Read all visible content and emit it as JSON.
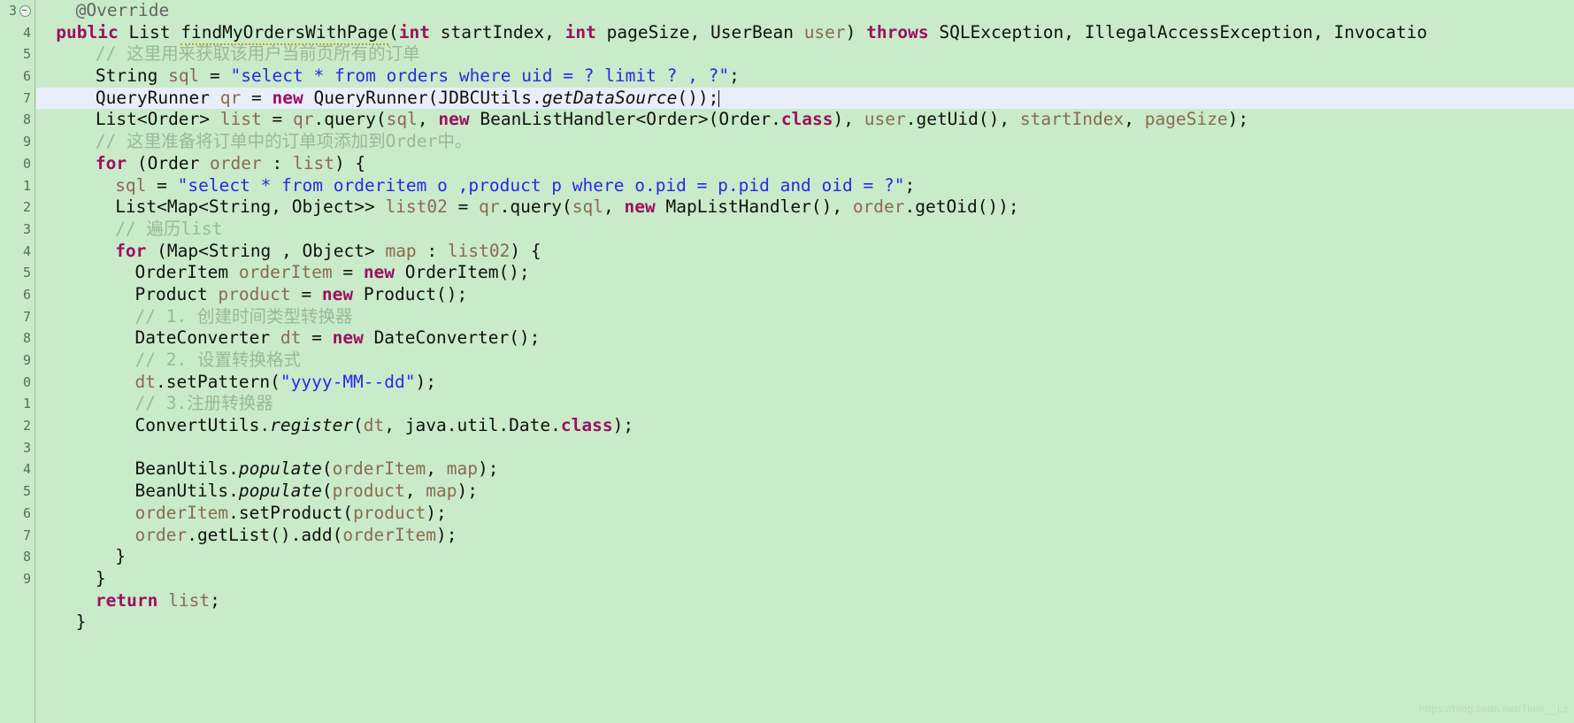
{
  "editor": {
    "language": "Java",
    "background_color": "#c9ebc9",
    "highlight_color": "#e9eefb",
    "gutter_border_color": "#9fb9a0",
    "caret_visible": true
  },
  "gutter": {
    "numbers": [
      "3",
      "4",
      "5",
      "6",
      "7",
      "8",
      "9",
      "0",
      "1",
      "2",
      "3",
      "4",
      "5",
      "6",
      "7",
      "8",
      "9",
      "0",
      "1",
      "2",
      "3",
      "4",
      "5",
      "6",
      "7",
      "8",
      "9"
    ],
    "fold_marker_line": 0,
    "fold_marker": "collapse-circle"
  },
  "highlighted_line_index": 4,
  "code_lines": [
    {
      "indent": 2,
      "tokens": [
        {
          "t": "@Override",
          "c": "annot"
        }
      ]
    },
    {
      "indent": 1,
      "tokens": [
        {
          "t": "public",
          "c": "kw"
        },
        {
          "t": " ",
          "c": "plain"
        },
        {
          "t": "List",
          "c": "type"
        },
        {
          "t": " ",
          "c": "plain"
        },
        {
          "t": "findMyOrdersWithPage",
          "c": "type squig"
        },
        {
          "t": "(",
          "c": "plain"
        },
        {
          "t": "int",
          "c": "kw"
        },
        {
          "t": " startIndex, ",
          "c": "plain"
        },
        {
          "t": "int",
          "c": "kw"
        },
        {
          "t": " pageSize, ",
          "c": "plain"
        },
        {
          "t": "UserBean ",
          "c": "type"
        },
        {
          "t": "user",
          "c": "loc"
        },
        {
          "t": ") ",
          "c": "plain"
        },
        {
          "t": "throws",
          "c": "kw"
        },
        {
          "t": " SQLException, IllegalAccessException, Invocatio",
          "c": "plain"
        }
      ]
    },
    {
      "indent": 3,
      "tokens": [
        {
          "t": "// ",
          "c": "cmt"
        },
        {
          "t": "这里用来获取该用户当前页所有的订单",
          "c": "cmt-cn"
        }
      ]
    },
    {
      "indent": 3,
      "tokens": [
        {
          "t": "String ",
          "c": "type"
        },
        {
          "t": "sql",
          "c": "loc"
        },
        {
          "t": " = ",
          "c": "plain"
        },
        {
          "t": "\"select * from orders where uid = ? limit ? , ?\"",
          "c": "str"
        },
        {
          "t": ";",
          "c": "plain"
        }
      ]
    },
    {
      "indent": 3,
      "tokens": [
        {
          "t": "QueryRunner ",
          "c": "type"
        },
        {
          "t": "qr",
          "c": "loc"
        },
        {
          "t": " = ",
          "c": "plain"
        },
        {
          "t": "new",
          "c": "kw"
        },
        {
          "t": " QueryRunner(JDBCUtils.",
          "c": "plain"
        },
        {
          "t": "getDataSource",
          "c": "plain ital"
        },
        {
          "t": "());",
          "c": "plain"
        },
        {
          "t": "__CARET__",
          "c": "caret"
        }
      ]
    },
    {
      "indent": 3,
      "tokens": [
        {
          "t": "List<Order> ",
          "c": "type"
        },
        {
          "t": "list",
          "c": "loc"
        },
        {
          "t": " = ",
          "c": "plain"
        },
        {
          "t": "qr",
          "c": "loc"
        },
        {
          "t": ".query(",
          "c": "plain"
        },
        {
          "t": "sql",
          "c": "loc"
        },
        {
          "t": ", ",
          "c": "plain"
        },
        {
          "t": "new",
          "c": "kw"
        },
        {
          "t": " BeanListHandler<Order>(Order.",
          "c": "plain"
        },
        {
          "t": "class",
          "c": "kw"
        },
        {
          "t": "), ",
          "c": "plain"
        },
        {
          "t": "user",
          "c": "loc"
        },
        {
          "t": ".getUid(), ",
          "c": "plain"
        },
        {
          "t": "startIndex",
          "c": "loc"
        },
        {
          "t": ", ",
          "c": "plain"
        },
        {
          "t": "pageSize",
          "c": "loc"
        },
        {
          "t": ");",
          "c": "plain"
        }
      ]
    },
    {
      "indent": 3,
      "tokens": [
        {
          "t": "// ",
          "c": "cmt"
        },
        {
          "t": "这里准备将订单中的订单项添加到Order中。",
          "c": "cmt-cn"
        }
      ]
    },
    {
      "indent": 3,
      "tokens": [
        {
          "t": "for",
          "c": "kw"
        },
        {
          "t": " (Order ",
          "c": "plain"
        },
        {
          "t": "order",
          "c": "loc"
        },
        {
          "t": " : ",
          "c": "plain"
        },
        {
          "t": "list",
          "c": "loc"
        },
        {
          "t": ") {",
          "c": "plain"
        }
      ]
    },
    {
      "indent": 4,
      "tokens": [
        {
          "t": "sql",
          "c": "loc"
        },
        {
          "t": " = ",
          "c": "plain"
        },
        {
          "t": "\"select * from orderitem o ,product p where o.pid = p.pid and oid = ?\"",
          "c": "str"
        },
        {
          "t": ";",
          "c": "plain"
        }
      ]
    },
    {
      "indent": 4,
      "tokens": [
        {
          "t": "List<Map<String, Object>> ",
          "c": "type"
        },
        {
          "t": "list02",
          "c": "loc"
        },
        {
          "t": " = ",
          "c": "plain"
        },
        {
          "t": "qr",
          "c": "loc"
        },
        {
          "t": ".query(",
          "c": "plain"
        },
        {
          "t": "sql",
          "c": "loc"
        },
        {
          "t": ", ",
          "c": "plain"
        },
        {
          "t": "new",
          "c": "kw"
        },
        {
          "t": " MapListHandler(), ",
          "c": "plain"
        },
        {
          "t": "order",
          "c": "loc"
        },
        {
          "t": ".getOid());",
          "c": "plain"
        }
      ]
    },
    {
      "indent": 4,
      "tokens": [
        {
          "t": "// ",
          "c": "cmt"
        },
        {
          "t": "遍历list",
          "c": "cmt-cn"
        }
      ]
    },
    {
      "indent": 4,
      "tokens": [
        {
          "t": "for",
          "c": "kw"
        },
        {
          "t": " (Map<String , Object> ",
          "c": "plain"
        },
        {
          "t": "map",
          "c": "loc"
        },
        {
          "t": " : ",
          "c": "plain"
        },
        {
          "t": "list02",
          "c": "loc"
        },
        {
          "t": ") {",
          "c": "plain"
        }
      ]
    },
    {
      "indent": 5,
      "tokens": [
        {
          "t": "OrderItem ",
          "c": "type"
        },
        {
          "t": "orderItem",
          "c": "loc"
        },
        {
          "t": " = ",
          "c": "plain"
        },
        {
          "t": "new",
          "c": "kw"
        },
        {
          "t": " OrderItem();",
          "c": "plain"
        }
      ]
    },
    {
      "indent": 5,
      "tokens": [
        {
          "t": "Product ",
          "c": "type"
        },
        {
          "t": "product",
          "c": "loc"
        },
        {
          "t": " = ",
          "c": "plain"
        },
        {
          "t": "new",
          "c": "kw"
        },
        {
          "t": " Product();",
          "c": "plain"
        }
      ]
    },
    {
      "indent": 5,
      "tokens": [
        {
          "t": "// 1. ",
          "c": "cmt"
        },
        {
          "t": "创建时间类型转换器",
          "c": "cmt-cn"
        }
      ]
    },
    {
      "indent": 5,
      "tokens": [
        {
          "t": "DateConverter ",
          "c": "type"
        },
        {
          "t": "dt",
          "c": "loc"
        },
        {
          "t": " = ",
          "c": "plain"
        },
        {
          "t": "new",
          "c": "kw"
        },
        {
          "t": " DateConverter();",
          "c": "plain"
        }
      ]
    },
    {
      "indent": 5,
      "tokens": [
        {
          "t": "// 2. ",
          "c": "cmt"
        },
        {
          "t": "设置转换格式",
          "c": "cmt-cn"
        }
      ]
    },
    {
      "indent": 5,
      "tokens": [
        {
          "t": "dt",
          "c": "loc"
        },
        {
          "t": ".setPattern(",
          "c": "plain"
        },
        {
          "t": "\"yyyy-MM--dd\"",
          "c": "str"
        },
        {
          "t": ");",
          "c": "plain"
        }
      ]
    },
    {
      "indent": 5,
      "tokens": [
        {
          "t": "// 3.",
          "c": "cmt"
        },
        {
          "t": "注册转换器",
          "c": "cmt-cn"
        }
      ]
    },
    {
      "indent": 5,
      "tokens": [
        {
          "t": "ConvertUtils.",
          "c": "plain"
        },
        {
          "t": "register",
          "c": "plain ital"
        },
        {
          "t": "(",
          "c": "plain"
        },
        {
          "t": "dt",
          "c": "loc"
        },
        {
          "t": ", java.util.Date.",
          "c": "plain"
        },
        {
          "t": "class",
          "c": "kw"
        },
        {
          "t": ");",
          "c": "plain"
        }
      ]
    },
    {
      "indent": 0,
      "tokens": []
    },
    {
      "indent": 5,
      "tokens": [
        {
          "t": "BeanUtils.",
          "c": "plain"
        },
        {
          "t": "populate",
          "c": "plain ital"
        },
        {
          "t": "(",
          "c": "plain"
        },
        {
          "t": "orderItem",
          "c": "loc"
        },
        {
          "t": ", ",
          "c": "plain"
        },
        {
          "t": "map",
          "c": "loc"
        },
        {
          "t": ");",
          "c": "plain"
        }
      ]
    },
    {
      "indent": 5,
      "tokens": [
        {
          "t": "BeanUtils.",
          "c": "plain"
        },
        {
          "t": "populate",
          "c": "plain ital"
        },
        {
          "t": "(",
          "c": "plain"
        },
        {
          "t": "product",
          "c": "loc"
        },
        {
          "t": ", ",
          "c": "plain"
        },
        {
          "t": "map",
          "c": "loc"
        },
        {
          "t": ");",
          "c": "plain"
        }
      ]
    },
    {
      "indent": 5,
      "tokens": [
        {
          "t": "orderItem",
          "c": "loc"
        },
        {
          "t": ".setProduct(",
          "c": "plain"
        },
        {
          "t": "product",
          "c": "loc"
        },
        {
          "t": ");",
          "c": "plain"
        }
      ]
    },
    {
      "indent": 5,
      "tokens": [
        {
          "t": "order",
          "c": "loc"
        },
        {
          "t": ".getList().add(",
          "c": "plain"
        },
        {
          "t": "orderItem",
          "c": "loc"
        },
        {
          "t": ");",
          "c": "plain"
        }
      ]
    },
    {
      "indent": 4,
      "tokens": [
        {
          "t": "}",
          "c": "plain"
        }
      ]
    },
    {
      "indent": 3,
      "tokens": [
        {
          "t": "}",
          "c": "plain"
        }
      ]
    },
    {
      "indent": 3,
      "tokens": [
        {
          "t": "return",
          "c": "kw"
        },
        {
          "t": " ",
          "c": "plain"
        },
        {
          "t": "list",
          "c": "loc"
        },
        {
          "t": ";",
          "c": "plain"
        }
      ]
    },
    {
      "indent": 2,
      "tokens": [
        {
          "t": "}",
          "c": "plain"
        }
      ]
    }
  ],
  "watermark": {
    "text": "https://blog.csdn.net/Time__Lz"
  }
}
